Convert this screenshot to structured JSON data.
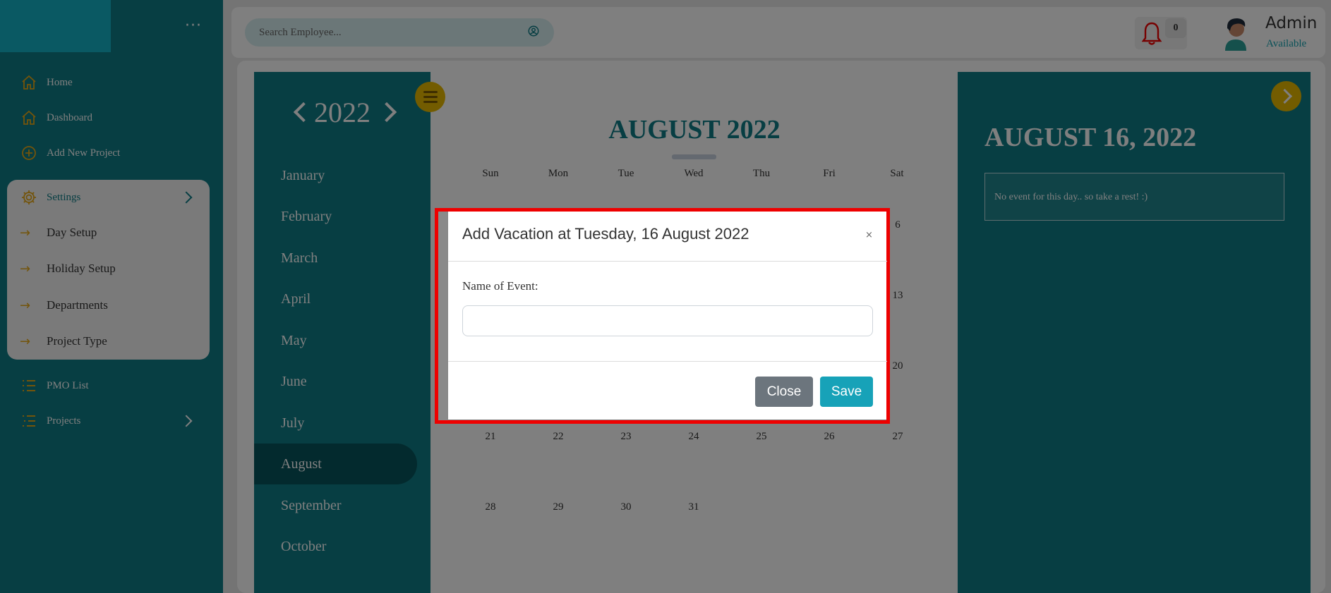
{
  "sidebar": {
    "menu_icon": "more-dots-icon",
    "items": [
      {
        "label": "Home",
        "icon": "home-icon"
      },
      {
        "label": "Dashboard",
        "icon": "home-icon"
      },
      {
        "label": "Add New Project",
        "icon": "plus-circle-icon"
      },
      {
        "label": "Settings",
        "icon": "gear-icon"
      },
      {
        "label": "PMO List",
        "icon": "list-icon"
      },
      {
        "label": "Projects",
        "icon": "list-icon"
      }
    ],
    "settings_sub": [
      "Day Setup",
      "Holiday Setup",
      "Departments",
      "Project Type"
    ]
  },
  "topbar": {
    "search_placeholder": "Search Employee...",
    "notification_count": "0",
    "admin_name": "Admin",
    "admin_status": "Available"
  },
  "calendar": {
    "year": "2022",
    "months": [
      "January",
      "February",
      "March",
      "April",
      "May",
      "June",
      "July",
      "August",
      "September",
      "October"
    ],
    "active_month": "August",
    "title": "AUGUST 2022",
    "weekdays": [
      "Sun",
      "Mon",
      "Tue",
      "Wed",
      "Thu",
      "Fri",
      "Sat"
    ],
    "visible_days": {
      "sat_col": [
        "6",
        "13",
        "20"
      ],
      "row4": [
        "21",
        "22",
        "23",
        "24",
        "25",
        "26",
        "27"
      ],
      "row5": [
        "28",
        "29",
        "30",
        "31"
      ]
    }
  },
  "day_panel": {
    "title": "AUGUST 16, 2022",
    "message": "No event for this day.. so take a rest! :)"
  },
  "modal": {
    "title": "Add Vacation at Tuesday, 16 August 2022",
    "close_x": "×",
    "field_label": "Name of Event:",
    "field_value": "",
    "close_label": "Close",
    "save_label": "Save"
  },
  "colors": {
    "teal": "#0e7c86",
    "accent_yellow": "#e6b800",
    "highlight_red": "#ee0000",
    "save_blue": "#17a2b8"
  }
}
